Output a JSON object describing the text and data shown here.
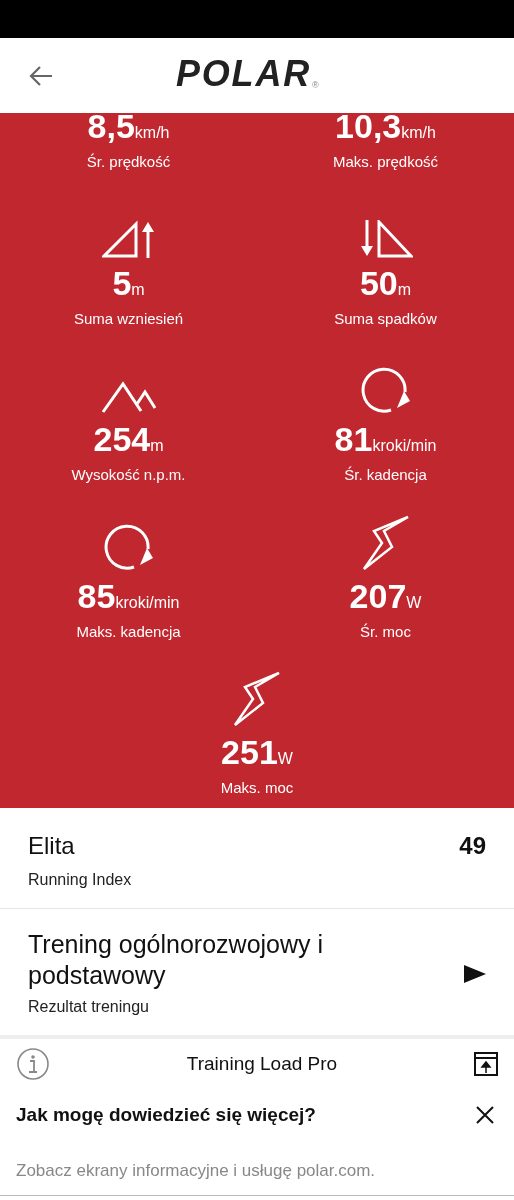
{
  "header": {
    "logo": "POLAR",
    "logo_mark": "®"
  },
  "stats": [
    {
      "kind": "speed",
      "value": "8,5",
      "unit": "km/h",
      "label": "Śr. prędkość"
    },
    {
      "kind": "speed",
      "value": "10,3",
      "unit": "km/h",
      "label": "Maks. prędkość"
    },
    {
      "kind": "ascent",
      "value": "5",
      "unit": "m",
      "label": "Suma wzniesień"
    },
    {
      "kind": "descent",
      "value": "50",
      "unit": "m",
      "label": "Suma spadków"
    },
    {
      "kind": "altitude",
      "value": "254",
      "unit": "m",
      "label": "Wysokość n.p.m."
    },
    {
      "kind": "cadence",
      "value": "81",
      "unit": "kroki/min",
      "label": "Śr. kadencja"
    },
    {
      "kind": "cadence",
      "value": "85",
      "unit": "kroki/min",
      "label": "Maks. kadencja"
    },
    {
      "kind": "power",
      "value": "207",
      "unit": "W",
      "label": "Śr. moc"
    },
    {
      "kind": "power",
      "value": "251",
      "unit": "W",
      "label": "Maks. moc"
    }
  ],
  "running_index": {
    "title": "Elita",
    "subtitle": "Running Index",
    "value": "49"
  },
  "training_benefit": {
    "title": "Trening ogólnorozwojowy i podstawowy",
    "subtitle": "Rezultat treningu"
  },
  "info_card": {
    "title": "Training Load Pro",
    "question": "Jak mogę dowiedzieć się więcej?",
    "text": "Zobacz ekrany informacyjne i usługę polar.com."
  }
}
